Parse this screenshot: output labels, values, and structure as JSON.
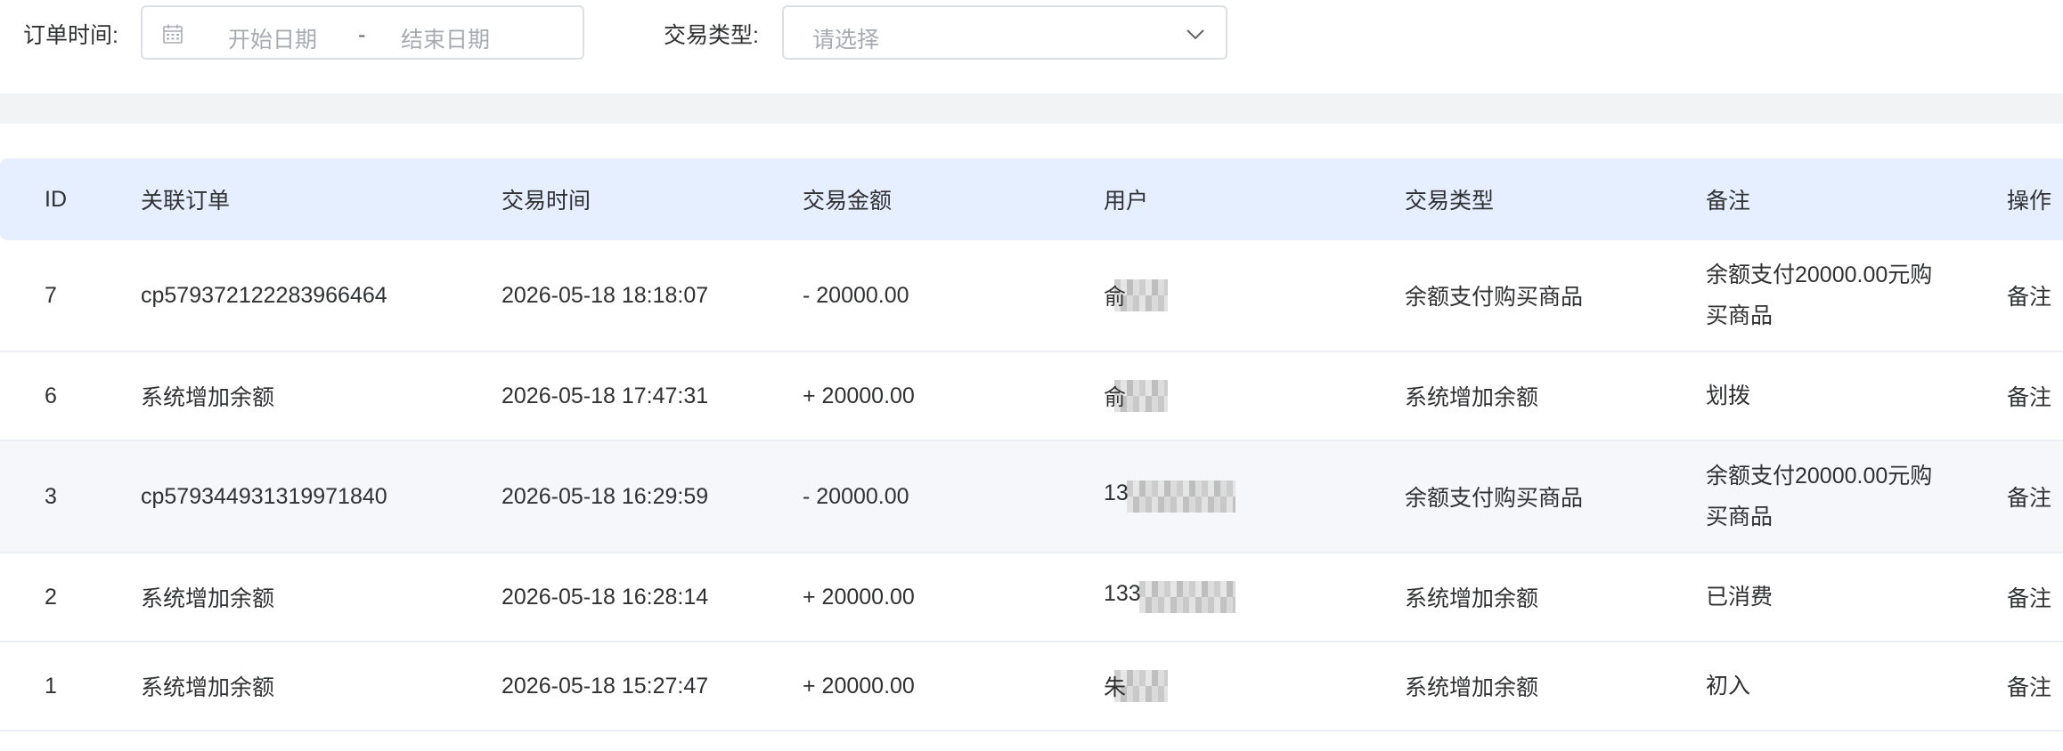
{
  "filters": {
    "order_time_label": "订单时间:",
    "start_placeholder": "开始日期",
    "range_separator": "-",
    "end_placeholder": "结束日期",
    "trade_type_label": "交易类型:",
    "trade_type_placeholder": "请选择"
  },
  "table": {
    "headers": [
      "ID",
      "关联订单",
      "交易时间",
      "交易金额",
      "用户",
      "交易类型",
      "备注",
      "操作"
    ],
    "rows": [
      {
        "id": "7",
        "order": "cp579372122283966464",
        "time": "2026-05-18 18:18:07",
        "amount": "- 20000.00",
        "amount_sign": "negative",
        "user": "俞",
        "type": "余额支付购买商品",
        "remark": "余额支付20000.00元购买商品",
        "action": "备注"
      },
      {
        "id": "6",
        "order": "系统增加余额",
        "time": "2026-05-18 17:47:31",
        "amount": "+ 20000.00",
        "amount_sign": "positive",
        "user": "俞",
        "type": "系统增加余额",
        "remark": "划拨",
        "action": "备注"
      },
      {
        "id": "3",
        "order": "cp579344931319971840",
        "time": "2026-05-18 16:29:59",
        "amount": "- 20000.00",
        "amount_sign": "negative",
        "user": "13",
        "type": "余额支付购买商品",
        "remark": "余额支付20000.00元购买商品",
        "action": "备注"
      },
      {
        "id": "2",
        "order": "系统增加余额",
        "time": "2026-05-18 16:28:14",
        "amount": "+ 20000.00",
        "amount_sign": "positive",
        "user": "133",
        "type": "系统增加余额",
        "remark": "已消费",
        "action": "备注"
      },
      {
        "id": "1",
        "order": "系统增加余额",
        "time": "2026-05-18 15:27:47",
        "amount": "+ 20000.00",
        "amount_sign": "positive",
        "user": "朱",
        "type": "系统增加余额",
        "remark": "初入",
        "action": "备注"
      }
    ]
  },
  "colors": {
    "negative_amount": "#0b8a2a",
    "positive_amount": "#e61e1e",
    "link": "#1e6fe6",
    "header_bg": "#e6efff"
  }
}
